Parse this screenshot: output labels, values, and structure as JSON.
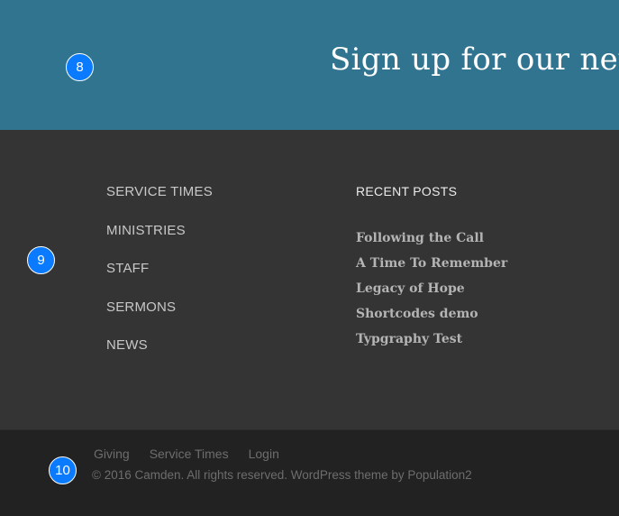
{
  "signup": {
    "title": "Sign up for our newsletter"
  },
  "markers": {
    "m8": "8",
    "m9": "9",
    "m10": "10"
  },
  "footer_menu": {
    "items": [
      {
        "label": "SERVICE TIMES"
      },
      {
        "label": "MINISTRIES"
      },
      {
        "label": "STAFF"
      },
      {
        "label": "SERMONS"
      },
      {
        "label": "NEWS"
      }
    ]
  },
  "recent_posts": {
    "heading": "RECENT POSTS",
    "posts": [
      {
        "title": "Following the Call"
      },
      {
        "title": "A Time To Remember"
      },
      {
        "title": "Legacy of Hope"
      },
      {
        "title": "Shortcodes demo"
      },
      {
        "title": "Typgraphy Test"
      }
    ]
  },
  "footer_bottom": {
    "links": [
      {
        "label": "Giving"
      },
      {
        "label": "Service Times"
      },
      {
        "label": "Login"
      }
    ],
    "copyright": "© 2016 Camden. All rights reserved. WordPress theme by Population2"
  }
}
